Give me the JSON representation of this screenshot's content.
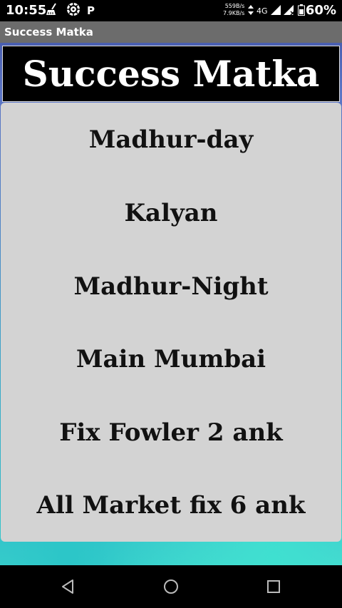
{
  "status_bar": {
    "time": "10:55",
    "left_icons": [
      "broom-icon",
      "settings-cog-icon",
      "p-icon"
    ],
    "p_icon_label": "P",
    "net_speed_up": "559B/s",
    "net_speed_down": "7.9KB/s",
    "network_type": "4G",
    "battery_percent": "60%"
  },
  "action_bar": {
    "title": "Success Matka"
  },
  "header": {
    "title": "Success Matka"
  },
  "menu": {
    "items": [
      {
        "label": "Madhur-day"
      },
      {
        "label": "Kalyan"
      },
      {
        "label": "Madhur-Night"
      },
      {
        "label": "Main Mumbai"
      },
      {
        "label": "Fix Fowler 2 ank"
      },
      {
        "label": "All Market fix 6 ank"
      }
    ]
  },
  "nav_bar": {
    "icons": [
      "back-icon",
      "home-icon",
      "recents-icon"
    ]
  },
  "colors": {
    "action_bar": "#6c6c6c",
    "menu_panel": "#d3d3d3",
    "header_bg": "#000000",
    "header_text": "#ffffff",
    "menu_text": "#111111"
  }
}
